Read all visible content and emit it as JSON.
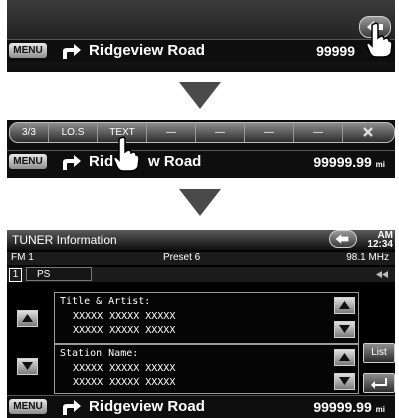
{
  "step1": {
    "menu_label": "MENU",
    "road": "Ridgeview Road",
    "distance": "99999",
    "back_icon": "back-arrow-icon"
  },
  "step2": {
    "page": "3/3",
    "buttons": [
      "LO.S",
      "TEXT",
      "—",
      "—",
      "—",
      "—"
    ],
    "close_icon": "close-x-icon",
    "menu_label": "MENU",
    "road_part1": "Rid",
    "road_part2": "w Road",
    "distance": "99999.99",
    "unit": "mi"
  },
  "step3": {
    "title": "TUNER Information",
    "band": "FM 1",
    "preset": "Preset 6",
    "freq": "98.1 MHz",
    "am_label": "AM",
    "time": "12:34",
    "slot_number": "1",
    "ps_label": "PS",
    "title_artist_label": "Title & Artist:",
    "title_artist_lines": [
      "XXXXX XXXXX XXXXX",
      "XXXXX XXXXX XXXXX"
    ],
    "station_label": "Station Name:",
    "station_lines": [
      "XXXXX XXXXX XXXXX",
      "XXXXX XXXXX XXXXX"
    ],
    "list_label": "List",
    "menu_label": "MENU",
    "road": "Ridgeview Road",
    "distance": "99999.99",
    "unit": "mi"
  }
}
